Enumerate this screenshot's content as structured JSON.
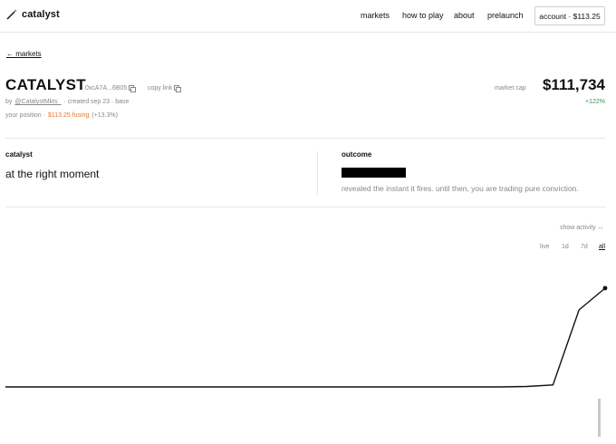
{
  "header": {
    "brand": "catalyst",
    "nav": [
      "markets",
      "how to play",
      "about",
      "prelaunch"
    ],
    "account": "account · $113.25"
  },
  "back": {
    "label": "← markets"
  },
  "market": {
    "title": "CATALYST",
    "address": "0xcA7A...6B05",
    "copy_link": "copy link",
    "by": "by",
    "creator": "@CatalystMkts_",
    "created": "· created sep 23 · base",
    "position_label": "your position ·",
    "position_value": "$113.25 fusing",
    "position_change": "(+13.3%)",
    "market_cap_label": "market cap",
    "market_cap": "$111,734",
    "change": "+122%"
  },
  "catalyst": {
    "label": "catalyst",
    "text": "at the right moment"
  },
  "outcome": {
    "label": "outcome",
    "description": "revealed the instant it fires. until then, you are trading pure conviction."
  },
  "chart": {
    "show_activity": "show activity ↔",
    "timeframes": [
      "live",
      "1d",
      "7d",
      "all"
    ],
    "selected": "all"
  },
  "chart_data": {
    "type": "line",
    "series": [
      {
        "values": [
          0,
          0,
          0,
          0,
          0,
          0,
          0,
          0,
          0,
          0,
          0,
          0,
          0,
          0,
          0,
          0,
          0,
          0,
          0,
          0,
          0.005,
          0.02,
          0.78,
          1.0
        ]
      }
    ],
    "colors": {
      "line": "#111111",
      "volume": "#c8c8c8"
    }
  }
}
